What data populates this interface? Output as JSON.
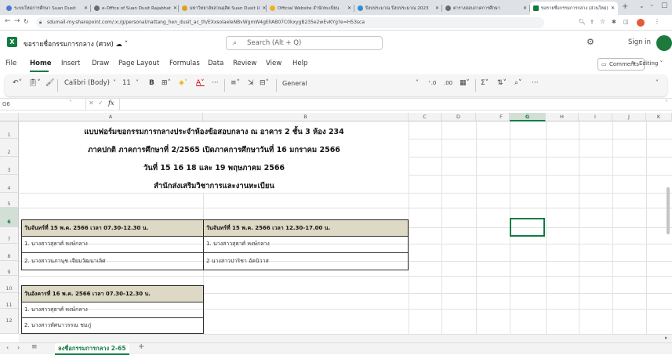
{
  "browser": {
    "tabs": [
      {
        "label": "ระบบใหม่การศึกษา Suan Dusit",
        "color": "#4a7bd0"
      },
      {
        "label": "e-Office of Suan Dusit Rajabhat",
        "color": "#6b6b6b"
      },
      {
        "label": "มหาวิทยาลัยสวนดุสิต Suan Dusit U",
        "color": "#e0a020"
      },
      {
        "label": "Official Website สำนักทะเบียน",
        "color": "#f2b01e"
      },
      {
        "label": "ปีงบประมาณ ปีงบประมาณ 2023",
        "color": "#2a8fd6"
      },
      {
        "label": "ตารางสอบภาคการศึกษา",
        "color": "#6b6b6b"
      },
      {
        "label": "ขอรายชื่อกรรมการกลาง (ส่วนใหม่)",
        "color": "#107c41"
      }
    ],
    "new_tab": "+",
    "url": "sdumail-my.sharepoint.com/:x:/g/personal/nattang_hen_dusit_ac_th/EXxsolaeleNBvWgmW4gElIAB07C0kxygB235e2wEvKYg?e=H53sca"
  },
  "excel": {
    "app_letter": "X",
    "doc_title": "ขอรายชื่อกรรมการกลาง (ศวท) ☁ ˅",
    "search_placeholder": "Search (Alt + Q)",
    "sign_in": "Sign in",
    "menu": [
      "File",
      "Home",
      "Insert",
      "Draw",
      "Page Layout",
      "Formulas",
      "Data",
      "Review",
      "View",
      "Help"
    ],
    "comments": "Comments",
    "editing": "Editing ˅",
    "ribbon": {
      "font_name": "Calibri (Body)",
      "font_size": "11",
      "number_format": "General",
      "more": "···"
    },
    "namebox": "G6",
    "fx": "fx"
  },
  "columns": [
    {
      "label": "A",
      "selected": false
    },
    {
      "label": "B",
      "selected": false
    },
    {
      "label": "C",
      "selected": false
    },
    {
      "label": "D",
      "selected": false
    },
    {
      "label": "E",
      "selected": false
    },
    {
      "label": "F",
      "selected": false
    },
    {
      "label": "G",
      "selected": true
    },
    {
      "label": "H",
      "selected": false
    },
    {
      "label": "I",
      "selected": false
    },
    {
      "label": "J",
      "selected": false
    },
    {
      "label": "K",
      "selected": false
    }
  ],
  "rows": [
    "1",
    "2",
    "3",
    "4",
    "5",
    "6",
    "7",
    "8",
    "9",
    "10",
    "11",
    "12"
  ],
  "titles": [
    "แบบฟอร์มขอกรรมการกลางประจำห้องข้อสอบกลาง ณ อาคาร 2 ชั้น 3 ห้อง 234",
    "ภาคปกติ ภาคการศึกษาที่ 2/2565 เปิดภาคการศึกษาวันที่ 16 มกราคม 2566",
    "วันที่  15  16  18 และ 19 พฤษภาคม 2566",
    "สำนักส่งเสริมวิชาการและงานทะเบียน"
  ],
  "schedule": {
    "mon_morning": {
      "header": "วันจันทร์ที่ 15 พ.ค. 2566      เวลา 07.30-12.30 น.",
      "names": [
        "1. นางสาวสุธาศ์  หงษ์กลาง",
        "2. นางสาวนภานุช  เจียมวัฒนาเลิศ"
      ]
    },
    "mon_afternoon": {
      "header": "วันจันทร์ที่ 15 พ.ค. 2566      เวลา 12.30-17.00 น.",
      "names": [
        "1. นางสาวสุธาศ์  หงษ์กลาง",
        "2 นางสาวปาริชา อัคนิวาส"
      ]
    },
    "tue_morning": {
      "header": "วันอังคารที่ 16 พ.ค. 2566      เวลา 07.30-12.30 น.",
      "names": [
        "1. นางสาวสุธาศ์  หงษ์กลาง",
        "2. นางสาวทัศนาวรรณ  ชมภู่"
      ]
    }
  },
  "sheet_tab": "ลงชื่อกรรมการกลาง 2-65",
  "add_sheet": "+"
}
